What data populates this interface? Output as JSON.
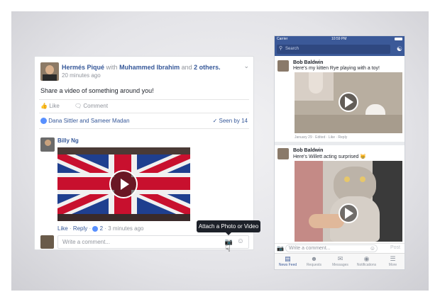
{
  "desktop_post": {
    "author": "Hermés Piqué",
    "with_text": "with",
    "tagged": "Muhammed Ibrahim",
    "and_text": "and",
    "others": "2 others.",
    "time": "20 minutes ago",
    "message": "Share a video of something around you!",
    "like_label": "Like",
    "comment_label": "Comment",
    "reactors": "Dana Sittler and Sameer Madan",
    "seen_by": "Seen by 14",
    "comment": {
      "author": "Billy Ng",
      "like_link": "Like",
      "reply_link": "Reply",
      "like_count": "2",
      "time": "3 minutes ago"
    },
    "composer_placeholder": "Write a comment...",
    "tooltip": "Attach a Photo or Video"
  },
  "phone": {
    "carrier": "Carrier",
    "clock": "10:59 PM",
    "search_placeholder": "Search",
    "posts": [
      {
        "author": "Bob Baldwin",
        "text": "Here's my kitten Rye playing with a toy!",
        "meta": "January 29 · Edited · Like · Reply"
      },
      {
        "author": "Bob Baldwin",
        "text": "Here's Willett acting surprised 😸"
      }
    ],
    "composer_placeholder": "Write a comment...",
    "post_label": "Post",
    "tabs": [
      "News Feed",
      "Requests",
      "Messages",
      "Notifications",
      "More"
    ]
  },
  "colors": {
    "brand": "#3b5998",
    "link": "#365899",
    "background": "#e4e4e8"
  }
}
